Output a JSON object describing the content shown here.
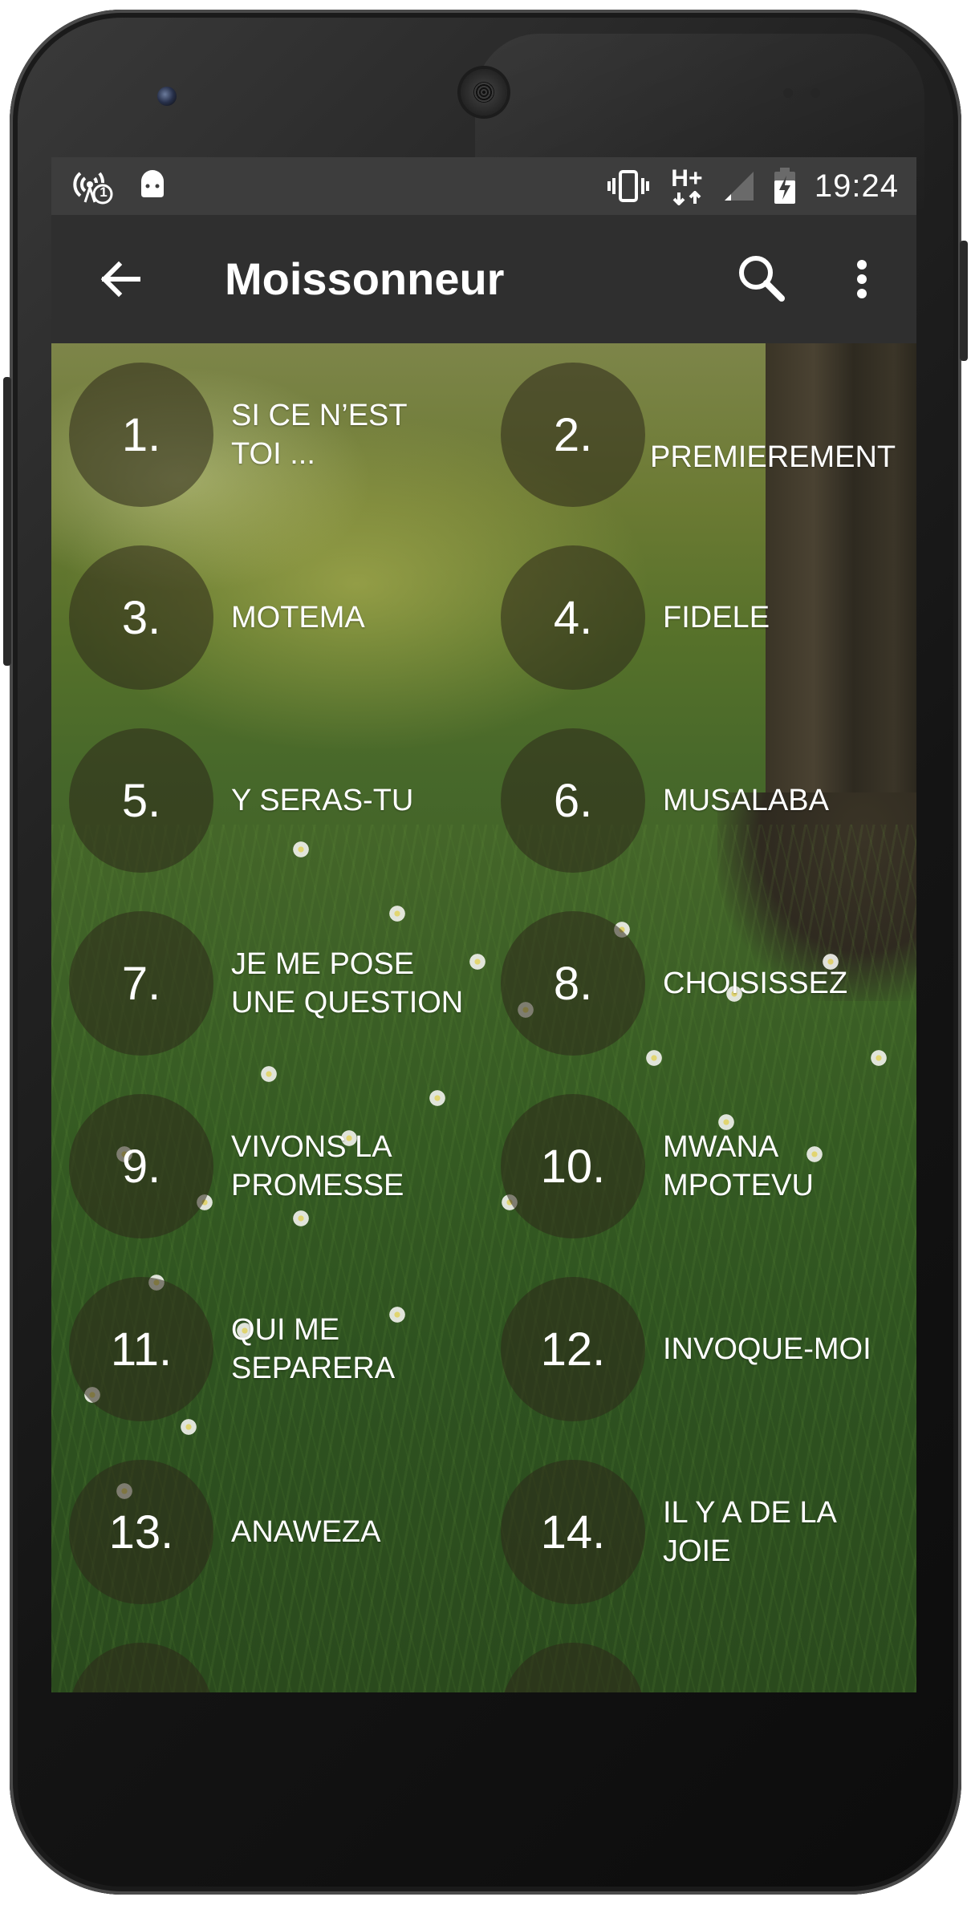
{
  "status_bar": {
    "time": "19:24",
    "network_type": "H+",
    "notification_count": "1",
    "icons": [
      "hotspot-icon",
      "android-icon",
      "vibrate-icon",
      "network-arrows-icon",
      "signal-icon",
      "battery-charging-icon"
    ]
  },
  "app_bar": {
    "title": "Moissonneur",
    "back_icon": "arrow-back-icon",
    "search_icon": "search-icon",
    "menu_icon": "more-vert-icon"
  },
  "songs": [
    {
      "number": "1.",
      "title": "SI CE N’EST\nTOI ..."
    },
    {
      "number": "2.",
      "title": "PREMIEREMENT"
    },
    {
      "number": "3.",
      "title": "MOTEMA"
    },
    {
      "number": "4.",
      "title": "FIDELE"
    },
    {
      "number": "5.",
      "title": "Y SERAS-TU"
    },
    {
      "number": "6.",
      "title": "MUSALABA"
    },
    {
      "number": "7.",
      "title": "JE ME POSE\nUNE QUESTION"
    },
    {
      "number": "8.",
      "title": "CHOISISSEZ"
    },
    {
      "number": "9.",
      "title": "VIVONS LA\nPROMESSE"
    },
    {
      "number": "10.",
      "title": "MWANA\nMPOTEVU"
    },
    {
      "number": "11.",
      "title": "QUI ME\nSEPARERA"
    },
    {
      "number": "12.",
      "title": "INVOQUE-MOI"
    },
    {
      "number": "13.",
      "title": "ANAWEZA"
    },
    {
      "number": "14.",
      "title": "IL Y A DE LA\nJOIE"
    }
  ],
  "colors": {
    "status_bar_bg": "#3d3d3d",
    "app_bar_bg": "#2f2f2f",
    "circle_bg": "rgba(45,40,25,0.55)",
    "text": "#ffffff"
  }
}
